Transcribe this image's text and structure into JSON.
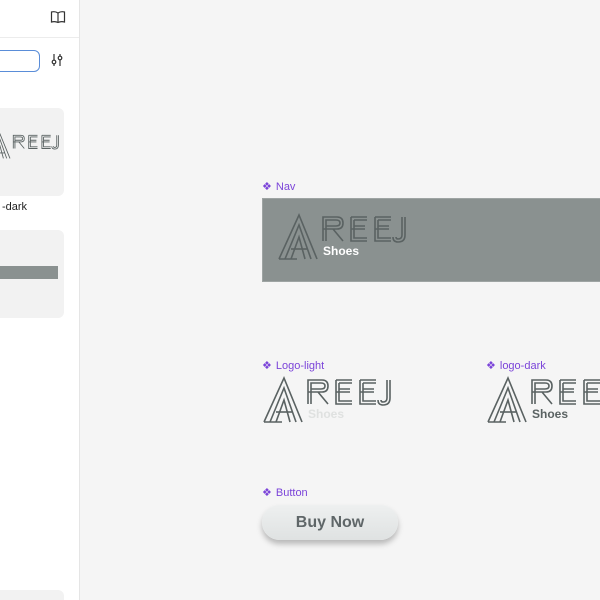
{
  "sidebar": {
    "search": {
      "value": "",
      "placeholder": ""
    },
    "thumbnails": [
      {
        "label": "-dark"
      }
    ]
  },
  "canvas": {
    "components": {
      "nav": {
        "label": "Nav"
      },
      "logo_light": {
        "label": "Logo-light"
      },
      "logo_dark": {
        "label": "logo-dark"
      },
      "button": {
        "label": "Button",
        "text": "Buy Now"
      }
    },
    "logo": {
      "wordmark": "AREEJ",
      "subtitle": "Shoes"
    }
  },
  "colors": {
    "accent": "#7b44d9",
    "nav_bg": "#8a9190",
    "logo_dark": "#5a6262",
    "logo_light": "#c9cccb",
    "canvas_bg": "#f5f5f5",
    "input_border": "#5a8dd8"
  },
  "icons": {
    "book": "book-icon",
    "filter": "filter-icon",
    "component": "component-icon"
  }
}
